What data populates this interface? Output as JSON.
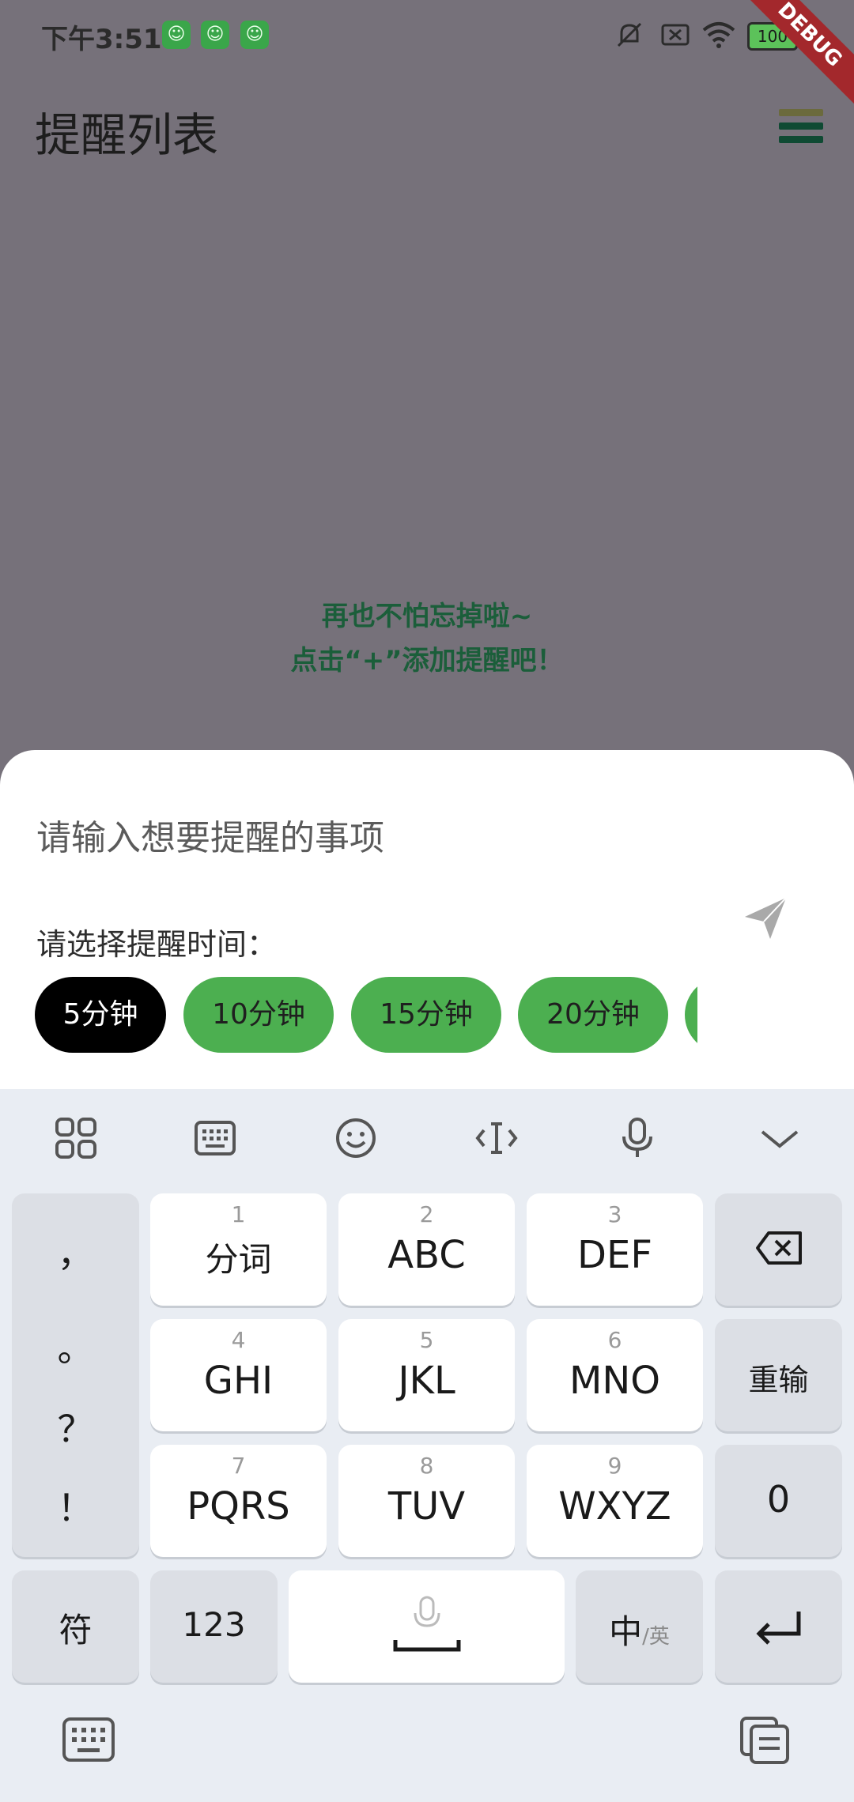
{
  "status_bar": {
    "time": "下午3:51",
    "battery": "100",
    "debug_label": "DEBUG"
  },
  "app": {
    "title": "提醒列表",
    "empty_hint_line1": "再也不怕忘掉啦~",
    "empty_hint_line2": "点击“+”添加提醒吧！"
  },
  "sheet": {
    "input_placeholder": "请输入想要提醒的事项",
    "time_label": "请选择提醒时间：",
    "chips": [
      "5分钟",
      "10分钟",
      "15分钟",
      "20分钟"
    ],
    "selected_chip": "5分钟"
  },
  "keyboard": {
    "punct": [
      "，",
      "。",
      "？",
      "！"
    ],
    "keys": [
      {
        "num": "1",
        "label": "分词"
      },
      {
        "num": "2",
        "label": "ABC"
      },
      {
        "num": "3",
        "label": "DEF"
      },
      {
        "num": "4",
        "label": "GHI"
      },
      {
        "num": "5",
        "label": "JKL"
      },
      {
        "num": "6",
        "label": "MNO"
      },
      {
        "num": "7",
        "label": "PQRS"
      },
      {
        "num": "8",
        "label": "TUV"
      },
      {
        "num": "9",
        "label": "WXYZ"
      }
    ],
    "reinput": "重输",
    "zero": "0",
    "symbols": "符",
    "numbers": "123",
    "lang_main": "中",
    "lang_sub": "/英"
  },
  "colors": {
    "accent_green": "#4caf50",
    "hint_green": "#1b5e3a",
    "overlay": "#76717a"
  }
}
